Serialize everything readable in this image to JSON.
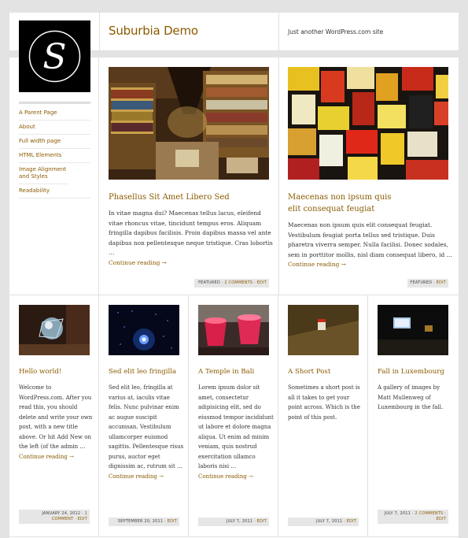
{
  "site": {
    "title": "Suburbia Demo",
    "description": "Just another WordPress.com site",
    "logo_letter": "S"
  },
  "nav": [
    {
      "label": "A Parent Page"
    },
    {
      "label": "About"
    },
    {
      "label": "Full width page"
    },
    {
      "label": "HTML Elements"
    },
    {
      "label": "Image Alignment and Styles"
    },
    {
      "label": "Readability"
    }
  ],
  "featured": [
    {
      "title": "Phasellus Sit Amet Libero Sed",
      "excerpt": "In vitae magna dui? Maecenas tellus lacus, eleifend vitae rhoncus vitae, tincidunt tempus eros. Aliquam fringilla dapibus facilisis. Proin dapibus massa vel ante dapibus non pellentesque neque tristique. Cras lobortis …",
      "more": "Continue reading →",
      "meta_label": "FEATURED",
      "meta_comments": "2 COMMENTS",
      "meta_edit": "EDIT",
      "image": "bookshop-icon"
    },
    {
      "title": "Maecenas non ipsum quis elit consequat feugiat",
      "excerpt": "Maecenas non ipsum quis elit consequat feugiat. Vestibulum feugiat porta tellus sed tristique. Duis pharetra viverra semper. Nulla facilisi. Donec sodales, sem in porttitor mollis, nisl diam consequat libero, id …",
      "more": "Continue reading →",
      "meta_label": "FEATURED",
      "meta_edit": "EDIT",
      "image": "posters-icon"
    }
  ],
  "posts": [
    {
      "title": "Hello world!",
      "excerpt": "Welcome to WordPress.com. After you read this, you should delete and write your own post, with a new title above. Or hit Add New on the left (of the admin …",
      "more": "Continue reading →",
      "date": "JANUARY 24, 2012",
      "comments": "1 COMMENT",
      "edit": "EDIT",
      "image": "glass-ball-icon"
    },
    {
      "title": "Sed elit leo fringilla",
      "excerpt": "Sed elit leo, fringilla at varius at, iaculis vitae felis. Nunc pulvinar enim ac augue suscipit accumsan. Vestibulum ullamcorper euismod sagittis. Pellentesque risus purus, auctor eget dignissim ac, rutrum sit …",
      "more": "Continue reading →",
      "date": "SEPTEMBER 20, 2011",
      "edit": "EDIT",
      "image": "blue-light-icon"
    },
    {
      "title": "A Temple in Bali",
      "excerpt": "Lorem ipsum dolor sit amet, consectetur adipisicing elit, sed do eiusmod tempor incididunt ut labore et dolore magna aliqua. Ut enim ad minim veniam, quis nostrud exercitation ullamco laboris nisi …",
      "more": "Continue reading →",
      "date": "JULY 7, 2011",
      "edit": "EDIT",
      "image": "red-cups-icon"
    },
    {
      "title": "A Short Post",
      "excerpt": "Sometimes a short post is all it takes to get your point across. Which is the point of this post.",
      "date": "JULY 7, 2011",
      "edit": "EDIT",
      "image": "street-sign-icon"
    },
    {
      "title": "Fall in Luxembourg",
      "excerpt": "A gallery of images by Matt Mullenweg of Luxembourg in the fall.",
      "date": "JULY 7, 2011",
      "comments": "2 COMMENTS",
      "edit": "EDIT",
      "image": "dark-bar-icon"
    }
  ],
  "colors": {
    "link": "#8a5a00",
    "background": "#e3e3e3",
    "meta_bg": "#e6e6e6"
  }
}
